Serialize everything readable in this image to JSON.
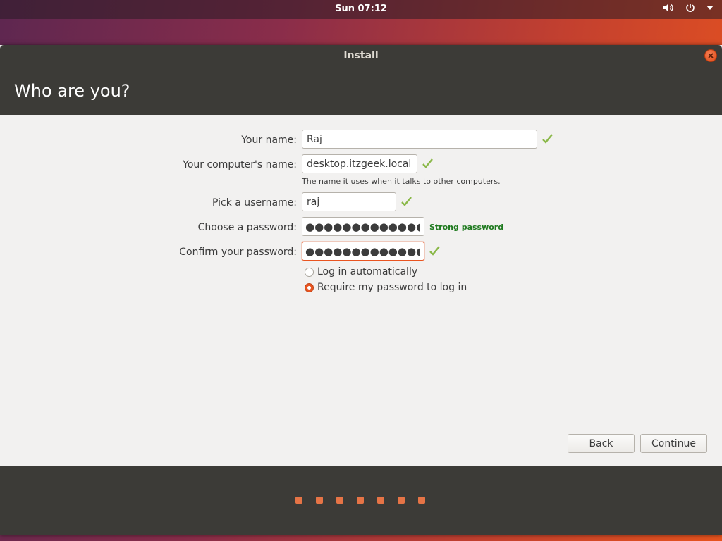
{
  "top_panel": {
    "clock": "Sun 07:12",
    "icons": [
      "volume-icon",
      "power-icon",
      "menu-arrow-icon"
    ]
  },
  "window": {
    "title": "Install",
    "close_icon": "close-icon"
  },
  "header": {
    "title": "Who are you?"
  },
  "form": {
    "your_name": {
      "label": "Your name:",
      "value": "Raj"
    },
    "computer_name": {
      "label": "Your computer's name:",
      "value": "desktop.itzgeek.local",
      "hint": "The name it uses when it talks to other computers."
    },
    "username": {
      "label": "Pick a username:",
      "value": "raj"
    },
    "password": {
      "label": "Choose a password:",
      "value": "●●●●●●●●●●●●●●",
      "strength": "Strong password"
    },
    "confirm_password": {
      "label": "Confirm your password:",
      "value": "●●●●●●●●●●●●●"
    },
    "login_options": [
      {
        "label": "Log in automatically",
        "selected": false
      },
      {
        "label": "Require my password to log in",
        "selected": true
      }
    ]
  },
  "buttons": {
    "back": "Back",
    "continue": "Continue"
  },
  "progress": {
    "total_steps": 7
  },
  "colors": {
    "accent": "#e95420",
    "header_bg": "#3c3b37",
    "content_bg": "#f2f1f0",
    "check_green": "#8ab848",
    "strength_green": "#1f7a1f"
  }
}
